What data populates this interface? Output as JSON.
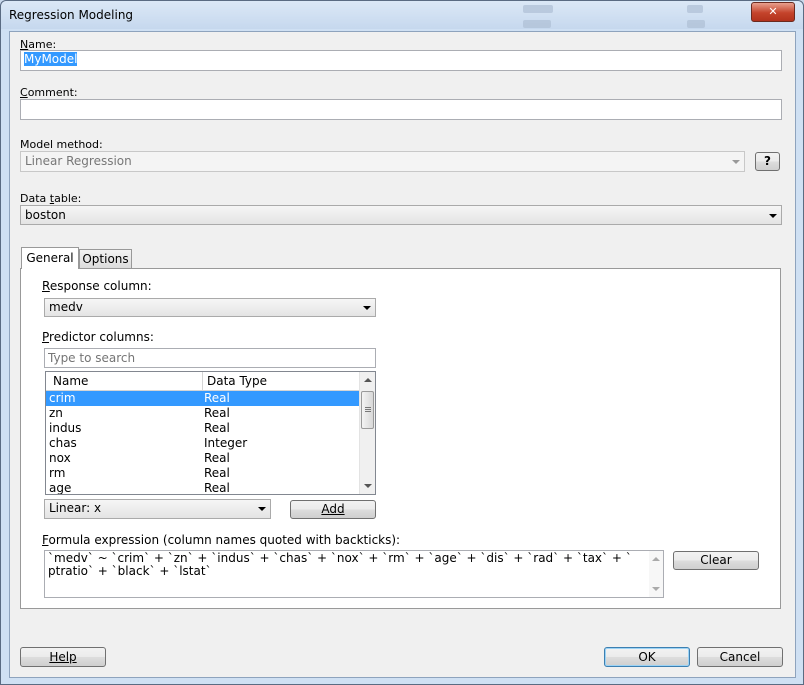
{
  "window": {
    "title": "Regression Modeling",
    "close_glyph": "✕"
  },
  "name_field": {
    "label": "Name:",
    "value": "MyModel"
  },
  "comment_field": {
    "label": "Comment:",
    "value": ""
  },
  "model_method": {
    "label": "Model method:",
    "value": "Linear Regression",
    "help_label": "?"
  },
  "data_table": {
    "label": "Data table:",
    "value": "boston"
  },
  "tabs": [
    {
      "label": "General"
    },
    {
      "label": "Options"
    }
  ],
  "general": {
    "response_label": "Response column:",
    "response_value": "medv",
    "predictor_label": "Predictor columns:",
    "search_placeholder": "Type to search",
    "columns_header": {
      "name": "Name",
      "type": "Data Type"
    },
    "columns": [
      {
        "name": "crim",
        "type": "Real"
      },
      {
        "name": "zn",
        "type": "Real"
      },
      {
        "name": "indus",
        "type": "Real"
      },
      {
        "name": "chas",
        "type": "Integer"
      },
      {
        "name": "nox",
        "type": "Real"
      },
      {
        "name": "rm",
        "type": "Real"
      },
      {
        "name": "age",
        "type": "Real"
      }
    ],
    "term_type_value": "Linear: x",
    "add_label": "Add",
    "formula_label": "Formula expression (column names quoted with backticks):",
    "formula_text": "`medv` ~ `crim` + `zn` + `indus` + `chas` + `nox` + `rm` + `age` + `dis` + `rad` + `tax` + `ptratio` + `black` + `lstat`",
    "clear_label": "Clear"
  },
  "footer": {
    "help_label": "Help",
    "ok_label": "OK",
    "cancel_label": "Cancel"
  }
}
